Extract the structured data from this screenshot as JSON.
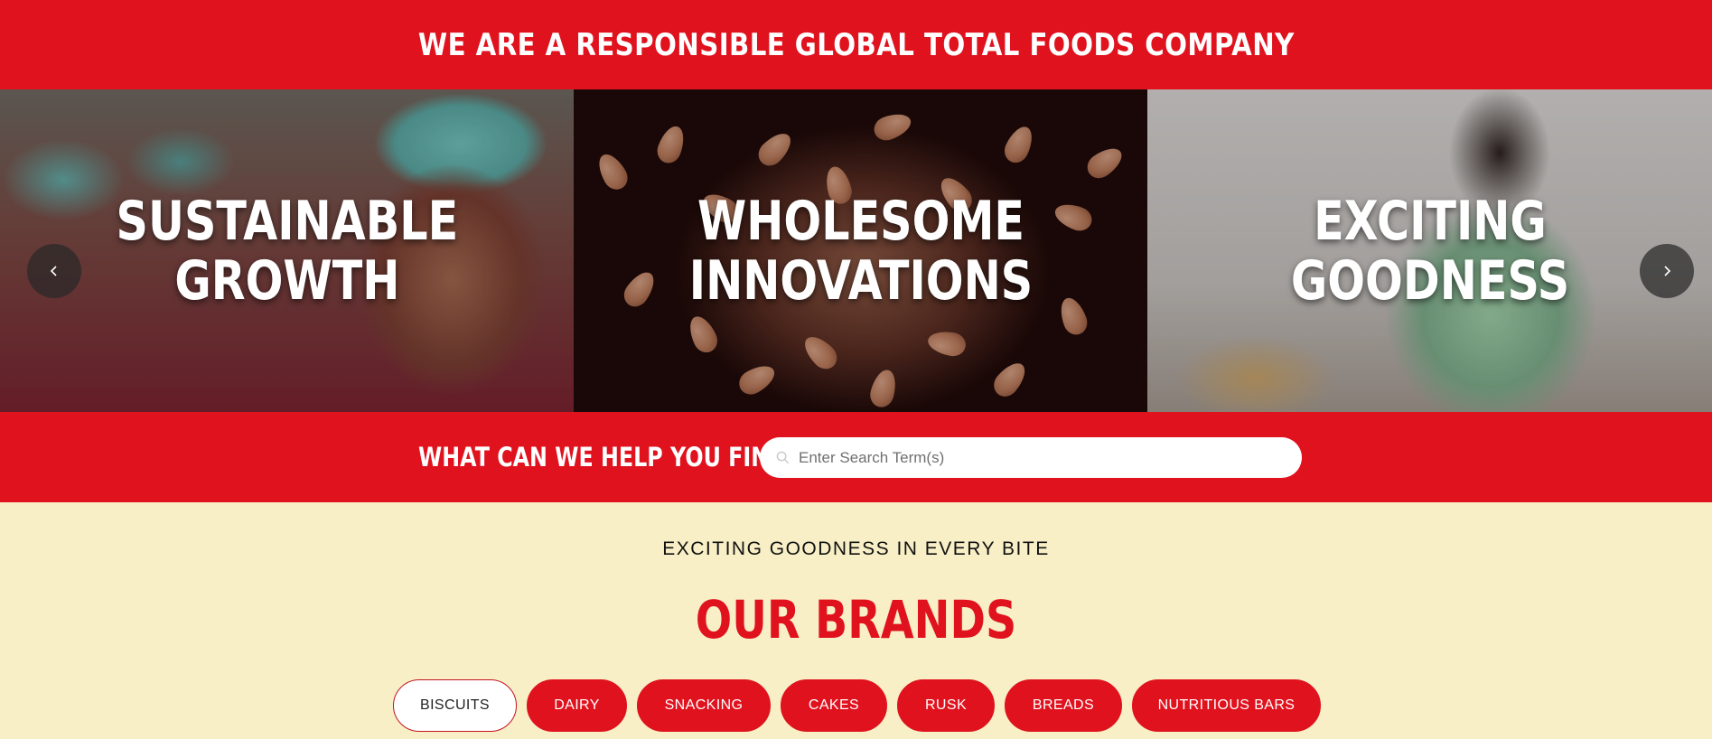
{
  "header": {
    "tagline": "WE ARE A RESPONSIBLE GLOBAL TOTAL FOODS COMPANY"
  },
  "carousel": {
    "slides": [
      {
        "line1": "SUSTAINABLE",
        "line2": "GROWTH"
      },
      {
        "line1": "WHOLESOME",
        "line2": "INNOVATIONS"
      },
      {
        "line1": "EXCITING",
        "line2": "GOODNESS"
      }
    ],
    "prev_icon": "chevron-left-icon",
    "next_icon": "chevron-right-icon"
  },
  "search": {
    "label": "WHAT CAN WE HELP YOU FIND?",
    "placeholder": "Enter Search Term(s)",
    "value": "",
    "icon": "search-icon"
  },
  "brands": {
    "kicker": "EXCITING GOODNESS IN EVERY BITE",
    "title": "OUR BRANDS",
    "active_tab": "BISCUITS",
    "tabs": [
      "BISCUITS",
      "DAIRY",
      "SNACKING",
      "CAKES",
      "RUSK",
      "BREADS",
      "NUTRITIOUS BARS"
    ]
  },
  "colors": {
    "brand_red": "#e0121e",
    "cream": "#f8efc6",
    "white": "#ffffff"
  }
}
